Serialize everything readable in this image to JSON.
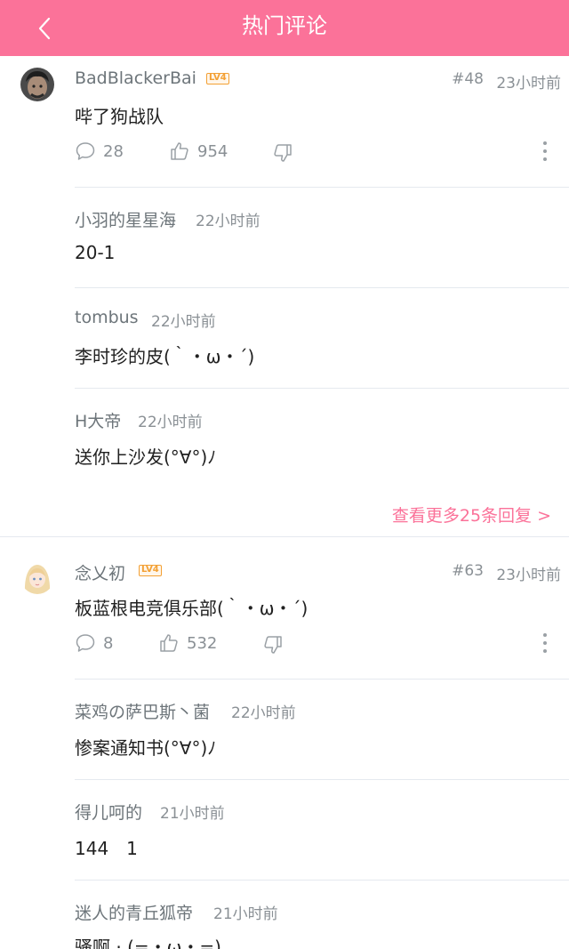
{
  "header": {
    "title": "热门评论"
  },
  "colors": {
    "accent": "#fb7299",
    "level": "#f3a034"
  },
  "comments": [
    {
      "user": "BadBlackerBai",
      "level": "LV4",
      "floor": "#48",
      "time": "23小时前",
      "text": "哔了狗战队",
      "reply_count": "28",
      "like_count": "954",
      "replies": [
        {
          "user": "小羽的星星海",
          "time": "22小时前",
          "text": "20-1"
        },
        {
          "user": "tombus",
          "time": "22小时前",
          "text": "李时珍的皮(｀・ω・´)"
        },
        {
          "user": "H大帝",
          "time": "22小时前",
          "text": "送你上沙发(°∀°)ﾉ"
        }
      ],
      "see_more": "查看更多25条回复 >"
    },
    {
      "user": "念乂初",
      "level": "LV4",
      "floor": "#63",
      "time": "23小时前",
      "text": "板蓝根电竞俱乐部(｀・ω・´)",
      "reply_count": "8",
      "like_count": "532",
      "replies": [
        {
          "user": "菜鸡の萨巴斯丶菌",
          "time": "22小时前",
          "text": "惨案通知书(°∀°)ﾉ"
        },
        {
          "user": "得儿呵的",
          "time": "21小时前",
          "text": "144　1"
        },
        {
          "user": "迷人的青丘狐帝",
          "time": "21小时前",
          "text": "骚啊 · (=・ω・=)"
        }
      ]
    }
  ]
}
